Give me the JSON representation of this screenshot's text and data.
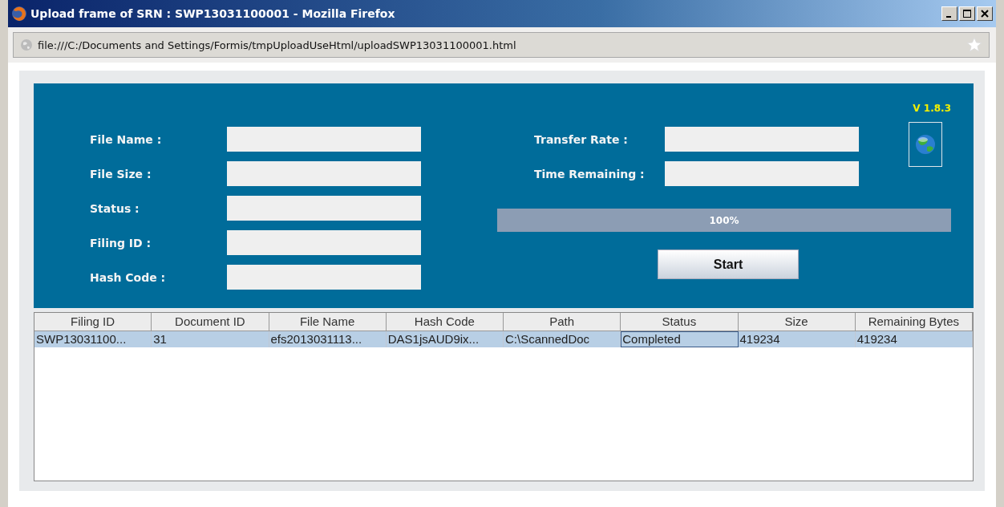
{
  "window": {
    "title": "Upload frame of SRN : SWP13031100001 - Mozilla Firefox"
  },
  "address_bar": {
    "url": "file:///C:/Documents and Settings/Formis/tmpUploadUseHtml/uploadSWP13031100001.html"
  },
  "version": "V 1.8.3",
  "left_fields": [
    {
      "label": "File Name :"
    },
    {
      "label": "File Size :"
    },
    {
      "label": "Status :"
    },
    {
      "label": "Filing ID :"
    },
    {
      "label": "Hash Code :"
    }
  ],
  "right_fields": [
    {
      "label": "Transfer Rate :"
    },
    {
      "label": "Time Remaining :"
    }
  ],
  "progress": {
    "level": 1,
    "reading": "100%"
  },
  "start_button": "Start",
  "table": {
    "columns": [
      "Filing ID",
      "Document ID",
      "File Name",
      "Hash Code",
      "Path",
      "Status",
      "Size",
      "Remaining Bytes"
    ],
    "rows": [
      {
        "selected": true,
        "cells": [
          "SWP13031100...",
          "31",
          "efs2013031113...",
          "DAS1jsAUD9ix...",
          "C:\\ScannedDoc",
          "Completed",
          "419234",
          "419234"
        ]
      }
    ]
  }
}
